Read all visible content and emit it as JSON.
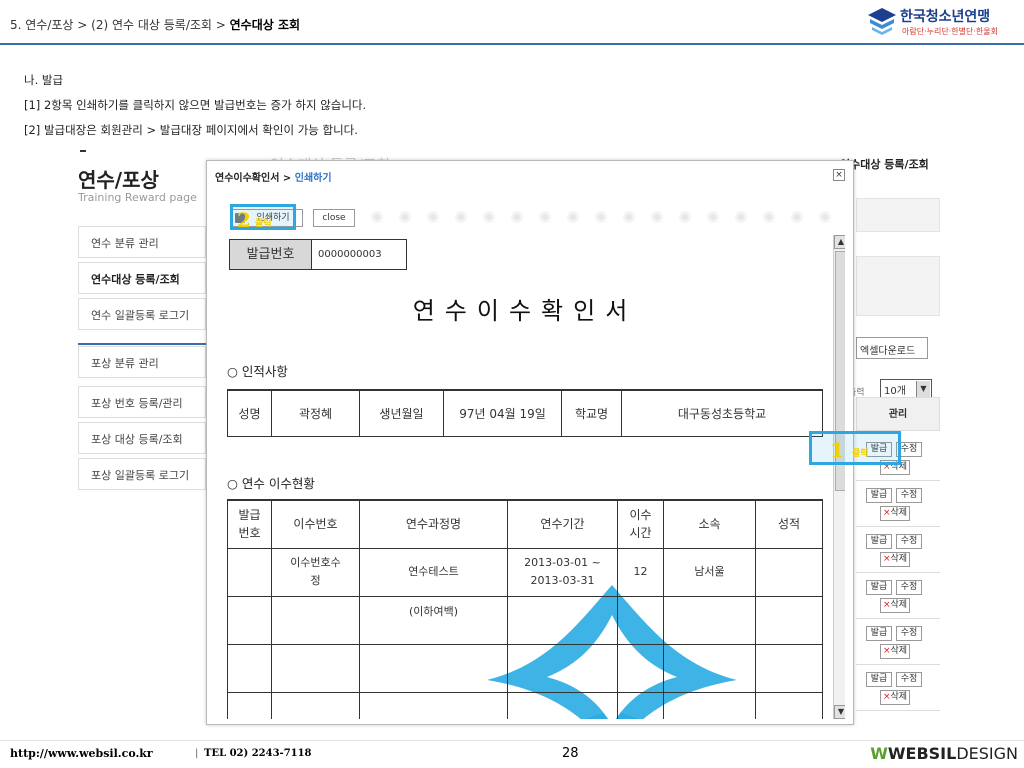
{
  "header": {
    "breadcrumb_prefix": "5. 연수/포상 > (2) 연수 대상 등록/조회 > ",
    "breadcrumb_current": "연수대상 조회",
    "logo_title": "한국청소년연맹",
    "logo_sub": "아람단·누리단·한별단·한울회"
  },
  "notes": {
    "heading": "나. 발급",
    "line1": "[1] 2항목 인쇄하기를 클릭하지 않으면 발급번호는 증가 하지 않습니다.",
    "line2": "[2] 발급대장은 회원관리 > 발급대장 페이지에서 확인이 가능 합니다."
  },
  "background_page": {
    "dash": "-",
    "title": "연수/포상",
    "subtitle": "Training Reward page",
    "behind_title": "연수대상 등록/조회",
    "right_title": "연수대상 등록/조회",
    "sidebar_group1": [
      "연수 분류 관리",
      "연수대상 등록/조회",
      "연수 일괄등록 로그기"
    ],
    "sidebar_group2": [
      "포상 분류 관리",
      "포상 번호 등록/관리",
      "포상 대상 등록/조회",
      "포상 일괄등록 로그기"
    ],
    "excel_button": "엑셀다운로드",
    "per_page_label": "출력",
    "per_page_value": "10개",
    "column_header": "관리",
    "row_buttons": {
      "issue": "발급",
      "edit": "수정",
      "delete_x": "×",
      "delete": "삭제"
    }
  },
  "modal": {
    "title_prefix": "연수이수확인서 > ",
    "title_link": "인쇄하기",
    "close_icon": "×",
    "print_button": "인쇄하기",
    "close_button": "close",
    "issue_label": "발급번호",
    "issue_number": "0000000003",
    "doc_title": "연수이수확인서",
    "section1": "○ 인적사항",
    "personal": {
      "name_label": "성명",
      "name_value": "곽정혜",
      "birth_label": "생년월일",
      "birth_value": "97년 04월 19일",
      "school_label": "학교명",
      "school_value": "대구동성초등학교"
    },
    "section2": "○ 연수 이수현황",
    "history_headers": [
      "발급\n번호",
      "이수번호",
      "연수과정명",
      "연수기간",
      "이수\n시간",
      "소속",
      "성적"
    ],
    "history_rows": [
      [
        "",
        "이수번호수\n정",
        "연수테스트",
        "2013-03-01 ~\n2013-03-31",
        "12",
        "남서울",
        ""
      ],
      [
        "",
        "",
        "(이하여백)",
        "",
        "",
        "",
        ""
      ],
      [
        "",
        "",
        "",
        "",
        "",
        "",
        ""
      ],
      [
        "",
        "",
        "",
        "",
        "",
        "",
        ""
      ]
    ]
  },
  "callouts": {
    "c1_num": "1",
    "c1_text": "클릭",
    "c2_num": "2",
    "c2_text": "클릭"
  },
  "footer": {
    "url": "http://www.websil.co.kr",
    "sep": "|",
    "tel": "TEL 02) 2243-7118",
    "page": "28",
    "brand_mark": "W",
    "brand_bold": "WEBSIL",
    "brand_rest": "DESIGN"
  },
  "colors": {
    "accent": "#3b6da8",
    "callout": "#2ea7e0",
    "callout_text": "#f4d000",
    "watermark": "#29abe2"
  }
}
